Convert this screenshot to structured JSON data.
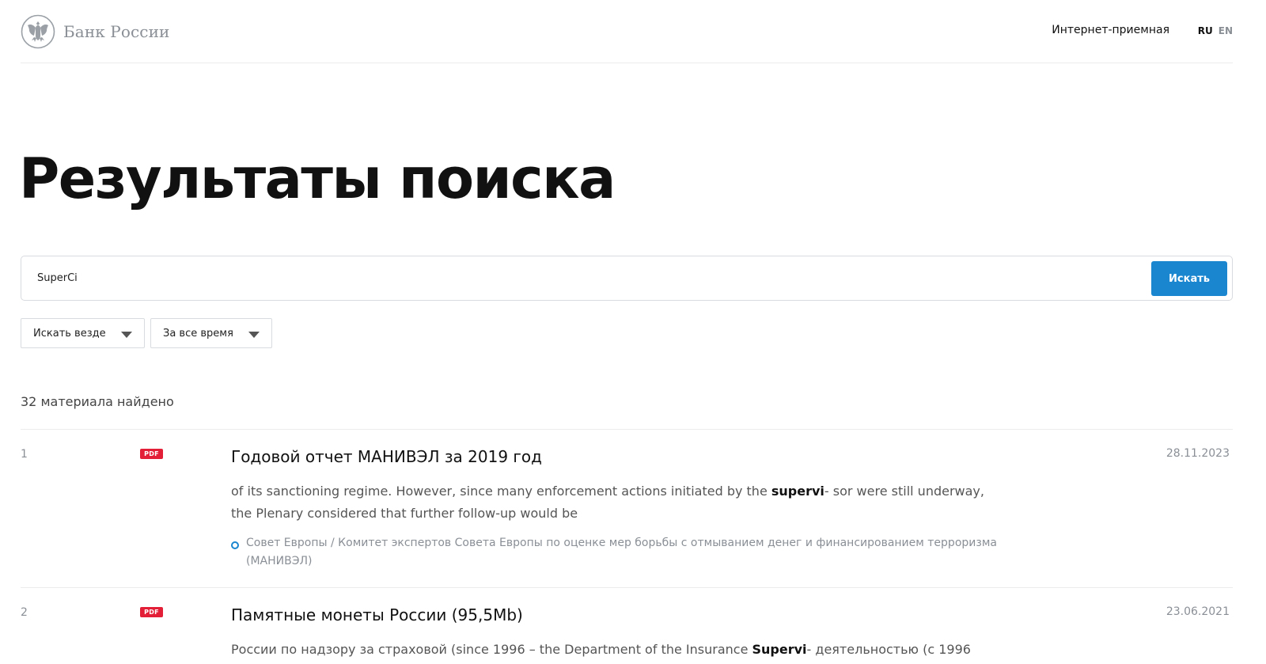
{
  "header": {
    "logo_text": "Банк России",
    "reception_link": "Интернет-приемная",
    "lang_ru": "RU",
    "lang_en": "EN"
  },
  "page": {
    "title": "Результаты поиска"
  },
  "search": {
    "value": "SuperCi",
    "button_label": "Искать"
  },
  "filters": {
    "area_label": "Искать везде",
    "time_label": "За все время"
  },
  "results_count": "32 материала найдено",
  "colors": {
    "accent": "#1a86d0",
    "pdf_badge": "#e21f36"
  },
  "results": [
    {
      "index": "1",
      "badge": "PDF",
      "title": "Годовой отчет МАНИВЭЛ за 2019 год",
      "date": "28.11.2023",
      "snippet_before": "of its sanctioning regime. However, since many enforcement actions initiated by the ",
      "snippet_highlight": "supervi",
      "snippet_after": "- sor were still underway, the Plenary considered that further follow-up would be",
      "source": "Совет Европы / Комитет экспертов Совета Европы по оценке мер борьбы с отмыванием денег и финансированием терроризма (МАНИВЭЛ)"
    },
    {
      "index": "2",
      "badge": "PDF",
      "title": "Памятные монеты России (95,5Mb)",
      "date": "23.06.2021",
      "snippet_before": "России по надзору за страховой (since 1996 – the Department of the Insurance ",
      "snippet_highlight": "Supervi",
      "snippet_after": "- деятельностью (с 1996",
      "source": ""
    }
  ]
}
